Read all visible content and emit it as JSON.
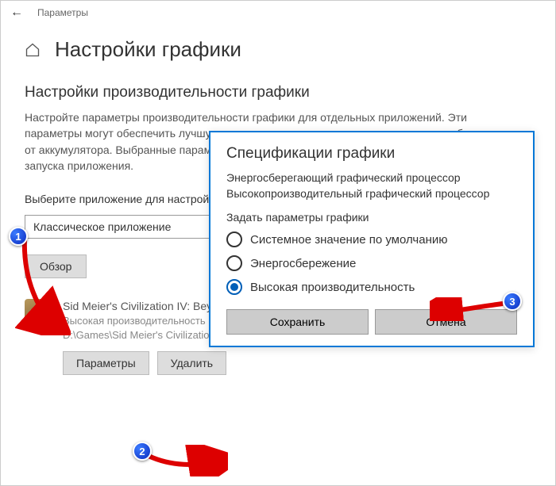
{
  "titlebar": {
    "label": "Параметры"
  },
  "page": {
    "title": "Настройки графики"
  },
  "section": {
    "title": "Настройки производительности графики",
    "desc": "Настройте параметры производительности графики для отдельных приложений. Эти параметры могут обеспечить лучшую производительность или увеличить время работы от аккумулятора. Выбранные параметры вступят в силу только после следующего запуска приложения."
  },
  "appSelect": {
    "label": "Выберите приложение для настройки",
    "value": "Классическое приложение"
  },
  "browse": "Обзор",
  "app": {
    "name": "Sid Meier's Civilization IV: Beyond the Sword",
    "status": "Высокая производительность",
    "path": "D:\\Games\\Sid Meier's Civilization 4 Complete(full Eng)\\Beyond the Sword\\Civ4BeyondSword.exe"
  },
  "appButtons": {
    "options": "Параметры",
    "delete": "Удалить"
  },
  "dialog": {
    "title": "Спецификации графики",
    "line1": "Энергосберегающий графический процессор",
    "line2": "Высокопроизводительный графический процессор",
    "prompt": "Задать параметры графики",
    "options": {
      "default": "Системное значение по умолчанию",
      "power": "Энергосбережение",
      "perf": "Высокая производительность"
    },
    "save": "Сохранить",
    "cancel": "Отмена"
  },
  "annotations": {
    "b1": "1",
    "b2": "2",
    "b3": "3"
  }
}
